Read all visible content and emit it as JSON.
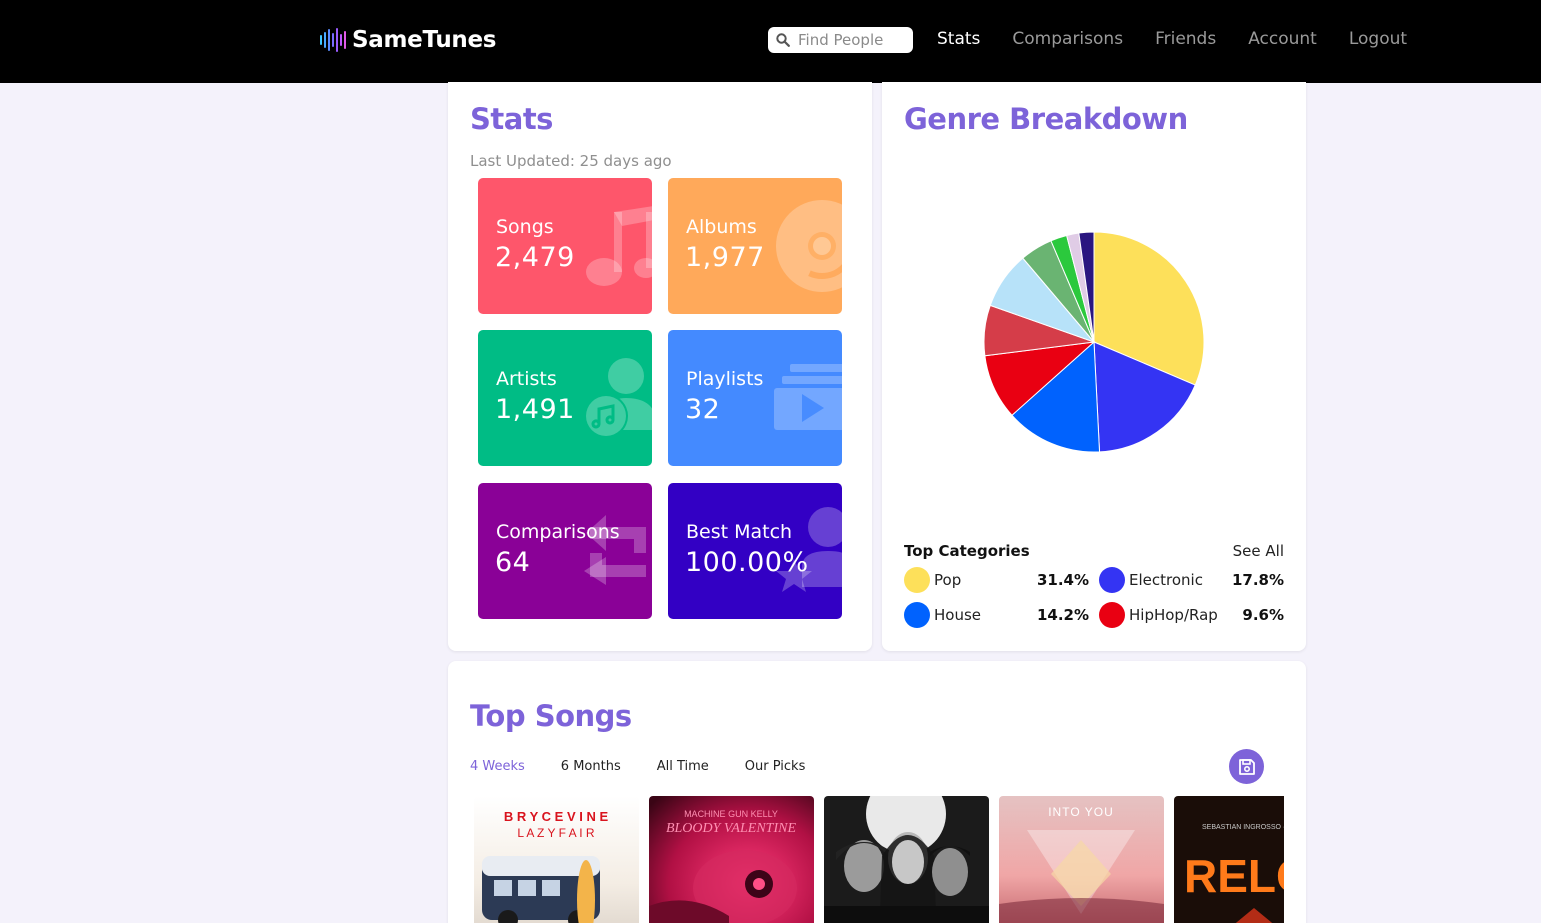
{
  "brand": {
    "name": "SameTunes"
  },
  "search": {
    "placeholder": "Find People"
  },
  "nav": {
    "stats": "Stats",
    "comparisons": "Comparisons",
    "friends": "Friends",
    "account": "Account",
    "logout": "Logout",
    "active": "Stats"
  },
  "stats": {
    "title": "Stats",
    "updated": "Last Updated: 25 days ago",
    "tiles": [
      {
        "label": "Songs",
        "value": "2,479",
        "color": "#fe566b",
        "icon": "music-note-icon"
      },
      {
        "label": "Albums",
        "value": "1,977",
        "color": "#ffa95a",
        "icon": "vinyl-disc-icon"
      },
      {
        "label": "Artists",
        "value": "1,491",
        "color": "#00bc85",
        "icon": "artist-icon"
      },
      {
        "label": "Playlists",
        "value": "32",
        "color": "#448aff",
        "icon": "playlist-icon"
      },
      {
        "label": "Comparisons",
        "value": "64",
        "color": "#8a0197",
        "icon": "swap-arrows-icon"
      },
      {
        "label": "Best Match",
        "value": "100.00%",
        "color": "#3300c4",
        "icon": "user-star-icon"
      }
    ]
  },
  "genre": {
    "title": "Genre Breakdown",
    "top_categories_label": "Top Categories",
    "see_all": "See All",
    "legend": [
      {
        "name": "Pop",
        "pct": "31.4%",
        "color": "#fde05a"
      },
      {
        "name": "Electronic",
        "pct": "17.8%",
        "color": "#3434f3"
      },
      {
        "name": "House",
        "pct": "14.2%",
        "color": "#0062fe"
      },
      {
        "name": "HipHop/Rap",
        "pct": "9.6%",
        "color": "#e90012"
      }
    ]
  },
  "chart_data": {
    "type": "pie",
    "title": "",
    "slices": [
      {
        "name": "Pop",
        "value": 31.4,
        "color": "#fde05a"
      },
      {
        "name": "Electronic",
        "value": 17.8,
        "color": "#3434f3"
      },
      {
        "name": "House",
        "value": 14.2,
        "color": "#0062fe"
      },
      {
        "name": "HipHop/Rap",
        "value": 9.6,
        "color": "#e90012"
      },
      {
        "name": "",
        "value": 7.4,
        "color": "#d53d49"
      },
      {
        "name": "",
        "value": 8.4,
        "color": "#b7e2f9"
      },
      {
        "name": "",
        "value": 4.8,
        "color": "#6ab472"
      },
      {
        "name": "",
        "value": 2.4,
        "color": "#2bc93d"
      },
      {
        "name": "",
        "value": 1.8,
        "color": "#e0cce6"
      },
      {
        "name": "",
        "value": 2.2,
        "color": "#2a1680"
      }
    ]
  },
  "top_songs": {
    "title": "Top Songs",
    "tabs": [
      "4 Weeks",
      "6 Months",
      "All Time",
      "Our Picks"
    ],
    "active_tab": "4 Weeks",
    "albums": [
      {
        "line1": "B R Y C E   V I N E",
        "line2": "L A Z Y   F A I R"
      },
      {
        "line1": "MACHINE GUN KELLY",
        "line2": "BLOODY VALENTINE"
      },
      {
        "line1": "",
        "line2": ""
      },
      {
        "line1": "INTO YOU",
        "line2": ""
      },
      {
        "line1": "RELO",
        "line2": ""
      }
    ]
  }
}
